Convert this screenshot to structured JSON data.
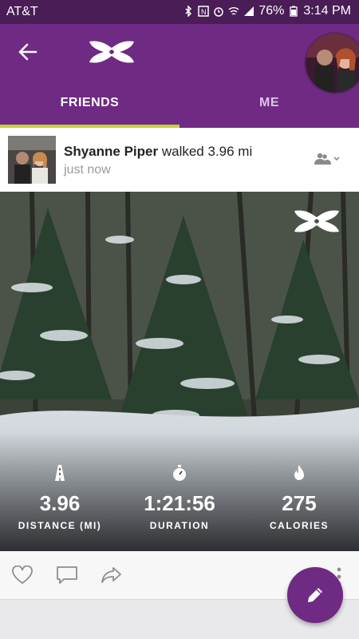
{
  "status_bar": {
    "carrier": "AT&T",
    "battery": "76%",
    "time": "3:14 PM"
  },
  "header": {
    "tabs": [
      {
        "label": "FRIENDS",
        "active": true
      },
      {
        "label": "ME",
        "active": false
      }
    ],
    "accent": "#6f2a83",
    "indicator_color": "#c8cf3a"
  },
  "post": {
    "user_name": "Shyanne Piper",
    "action": "walked 3.96 mi",
    "time": "just now",
    "stats": [
      {
        "icon": "road-icon",
        "value": "3.96",
        "label": "DISTANCE (MI)"
      },
      {
        "icon": "stopwatch-icon",
        "value": "1:21:56",
        "label": "DURATION"
      },
      {
        "icon": "flame-icon",
        "value": "275",
        "label": "CALORIES"
      }
    ]
  },
  "actions": [
    "heart-icon",
    "comment-icon",
    "share-icon",
    "more-icon"
  ],
  "fab": {
    "icon": "pencil-icon"
  }
}
